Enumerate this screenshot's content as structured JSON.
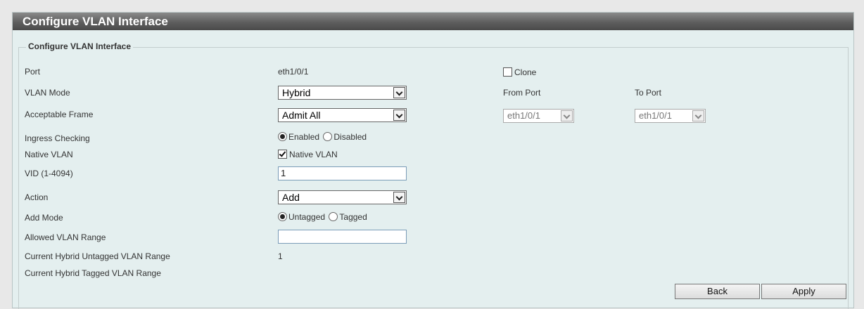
{
  "title": "Configure VLAN Interface",
  "section_legend": "Configure VLAN Interface",
  "fields": {
    "port": {
      "label": "Port",
      "value": "eth1/0/1"
    },
    "vlan_mode": {
      "label": "VLAN Mode",
      "value": "Hybrid"
    },
    "acceptable_frame": {
      "label": "Acceptable Frame",
      "value": "Admit All"
    },
    "ingress_checking": {
      "label": "Ingress Checking",
      "option_enabled": "Enabled",
      "option_disabled": "Disabled",
      "selected": "Enabled"
    },
    "native_vlan": {
      "label": "Native VLAN",
      "checkbox_label": "Native VLAN",
      "checked": true
    },
    "vid": {
      "label": "VID (1-4094)",
      "value": "1"
    },
    "action": {
      "label": "Action",
      "value": "Add"
    },
    "add_mode": {
      "label": "Add Mode",
      "option_untagged": "Untagged",
      "option_tagged": "Tagged",
      "selected": "Untagged"
    },
    "allowed_vlan_range": {
      "label": "Allowed VLAN Range",
      "value": ""
    },
    "current_untagged": {
      "label": "Current Hybrid Untagged VLAN Range",
      "value": "1"
    },
    "current_tagged": {
      "label": "Current Hybrid Tagged VLAN Range",
      "value": ""
    }
  },
  "clone": {
    "label": "Clone",
    "checked": false
  },
  "from_port": {
    "label": "From Port",
    "value": "eth1/0/1"
  },
  "to_port": {
    "label": "To Port",
    "value": "eth1/0/1"
  },
  "buttons": {
    "back": "Back",
    "apply": "Apply"
  }
}
